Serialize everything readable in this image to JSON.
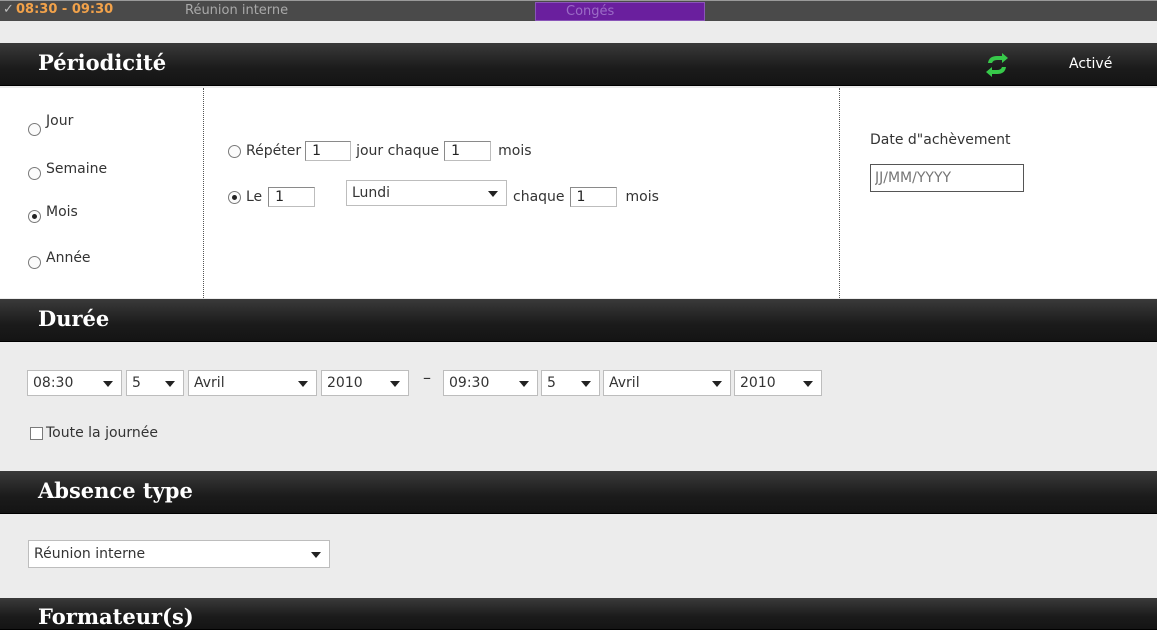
{
  "top_strip": {
    "check": "✓",
    "time": "08:30 - 09:30",
    "title": "Réunion interne",
    "conges": "Congés"
  },
  "periodicite": {
    "title": "Périodicité",
    "status": "Activé",
    "frequency_options": [
      {
        "label": "Jour",
        "checked": false
      },
      {
        "label": "Semaine",
        "checked": false
      },
      {
        "label": "Mois",
        "checked": true
      },
      {
        "label": "Année",
        "checked": false
      }
    ],
    "repeat_label": "Répéter",
    "repeat_value": "1",
    "day_each_label": "jour chaque",
    "day_each_value": "1",
    "months_label": "mois",
    "le_label": "Le",
    "le_value": "1",
    "weekday": "Lundi",
    "chaque_label": "chaque",
    "chaque_value": "1",
    "months_label2": "mois",
    "end_date_label": "Date d\"achèvement",
    "end_date_placeholder": "JJ/MM/YYYY"
  },
  "duree": {
    "title": "Durée",
    "start_time": "08:30",
    "start_day": "5",
    "start_month": "Avril",
    "start_year": "2010",
    "separator": "–",
    "end_time": "09:30",
    "end_day": "5",
    "end_month": "Avril",
    "end_year": "2010",
    "all_day_label": "Toute la journée"
  },
  "absence": {
    "title": "Absence type",
    "selected": "Réunion interne"
  },
  "formateurs": {
    "title": "Formateur(s)"
  },
  "colors": {
    "header_bg": "#1b1b1b",
    "time_orange": "#f2a24a",
    "conges_purple": "#6a1f9e",
    "refresh_green": "#37c94a"
  }
}
